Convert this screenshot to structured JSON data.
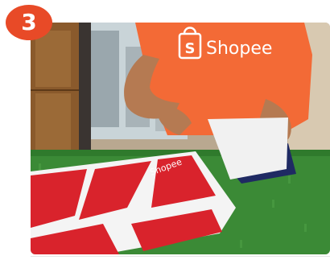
{
  "step": {
    "number": "3"
  },
  "photo": {
    "shirt_logo_text": "Shopee",
    "bag_logo_text": "Shopee",
    "colors": {
      "shirt": "#f36a36",
      "bag_red": "#d9232c",
      "grass": "#3b8a36",
      "wood": "#8a5a2c",
      "badge": "#e84a27"
    }
  }
}
